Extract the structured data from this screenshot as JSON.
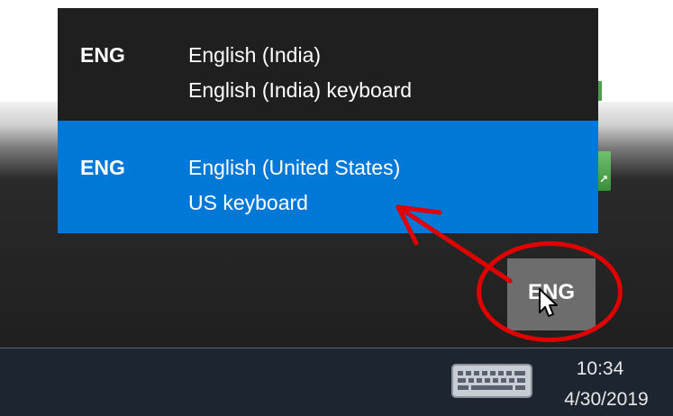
{
  "language_popup": {
    "options": [
      {
        "code": "ENG",
        "language": "English (India)",
        "keyboard": "English (India) keyboard",
        "selected": false
      },
      {
        "code": "ENG",
        "language": "English (United States)",
        "keyboard": "US keyboard",
        "selected": true
      }
    ]
  },
  "taskbar": {
    "language_indicator": "ENG",
    "keyboard_icon": "touch-keyboard-icon",
    "clock": {
      "time": "10:34",
      "date": "4/30/2019"
    }
  },
  "annotation": {
    "color": "#e00000"
  },
  "colors": {
    "selected_bg": "#0078d7",
    "popup_bg": "#1f1f1f",
    "taskbar_bg": "#1c2530"
  }
}
